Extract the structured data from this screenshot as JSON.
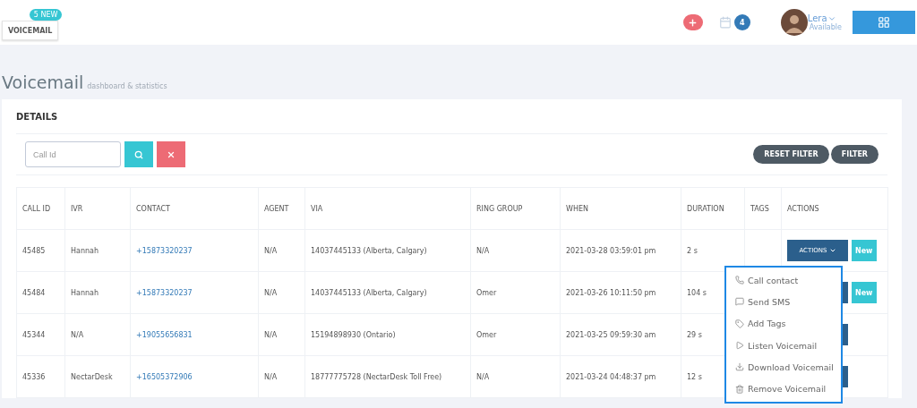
{
  "header": {
    "voicemail_button": "VOICEMAIL",
    "new_badge": "5 NEW",
    "calendar_count": "4",
    "user": {
      "name": "Lera",
      "status": "Available"
    }
  },
  "page": {
    "title": "Voicemail",
    "subtitle": "dashboard & statistics"
  },
  "details": {
    "title": "DETAILS",
    "search": {
      "placeholder": "Call Id"
    },
    "filter_buttons": [
      "RESET FILTER",
      "FILTER"
    ]
  },
  "table": {
    "columns": [
      "CALL ID",
      "IVR",
      "CONTACT",
      "AGENT",
      "VIA",
      "RING GROUP",
      "WHEN",
      "DURATION",
      "TAGS",
      "ACTIONS"
    ],
    "rows": [
      {
        "call_id": "45485",
        "ivr": "Hannah",
        "contact": "+15873320237",
        "agent": "N/A",
        "via": "14037445133 (Alberta, Calgary)",
        "ring_group": "N/A",
        "when": "2021-03-28 03:59:01 pm",
        "duration": "2 s",
        "actions_label": "ACTIONS",
        "new": "New"
      },
      {
        "call_id": "45484",
        "ivr": "Hannah",
        "contact": "+15873320237",
        "agent": "N/A",
        "via": "14037445133 (Alberta, Calgary)",
        "ring_group": "Omer",
        "when": "2021-03-26 10:11:50 pm",
        "duration": "104 s",
        "new": "New"
      },
      {
        "call_id": "45344",
        "ivr": "N/A",
        "contact": "+19055656831",
        "agent": "N/A",
        "via": "15194898930 (Ontario)",
        "ring_group": "Omer",
        "when": "2021-03-25 09:59:30 am",
        "duration": "29 s"
      },
      {
        "call_id": "45336",
        "ivr": "NectarDesk",
        "contact": "+16505372906",
        "agent": "N/A",
        "via": "18777775728 (NectarDesk Toll Free)",
        "ring_group": "N/A",
        "when": "2021-03-24 04:48:37 pm",
        "duration": "12 s"
      }
    ]
  },
  "actions_menu": [
    {
      "kind": "phone",
      "label": "Call contact"
    },
    {
      "kind": "sms",
      "label": "Send SMS"
    },
    {
      "kind": "tag",
      "label": "Add Tags"
    },
    {
      "kind": "play",
      "label": "Listen Voicemail"
    },
    {
      "kind": "download",
      "label": "Download Voicemail"
    },
    {
      "kind": "trash",
      "label": "Remove Voicemail"
    }
  ]
}
